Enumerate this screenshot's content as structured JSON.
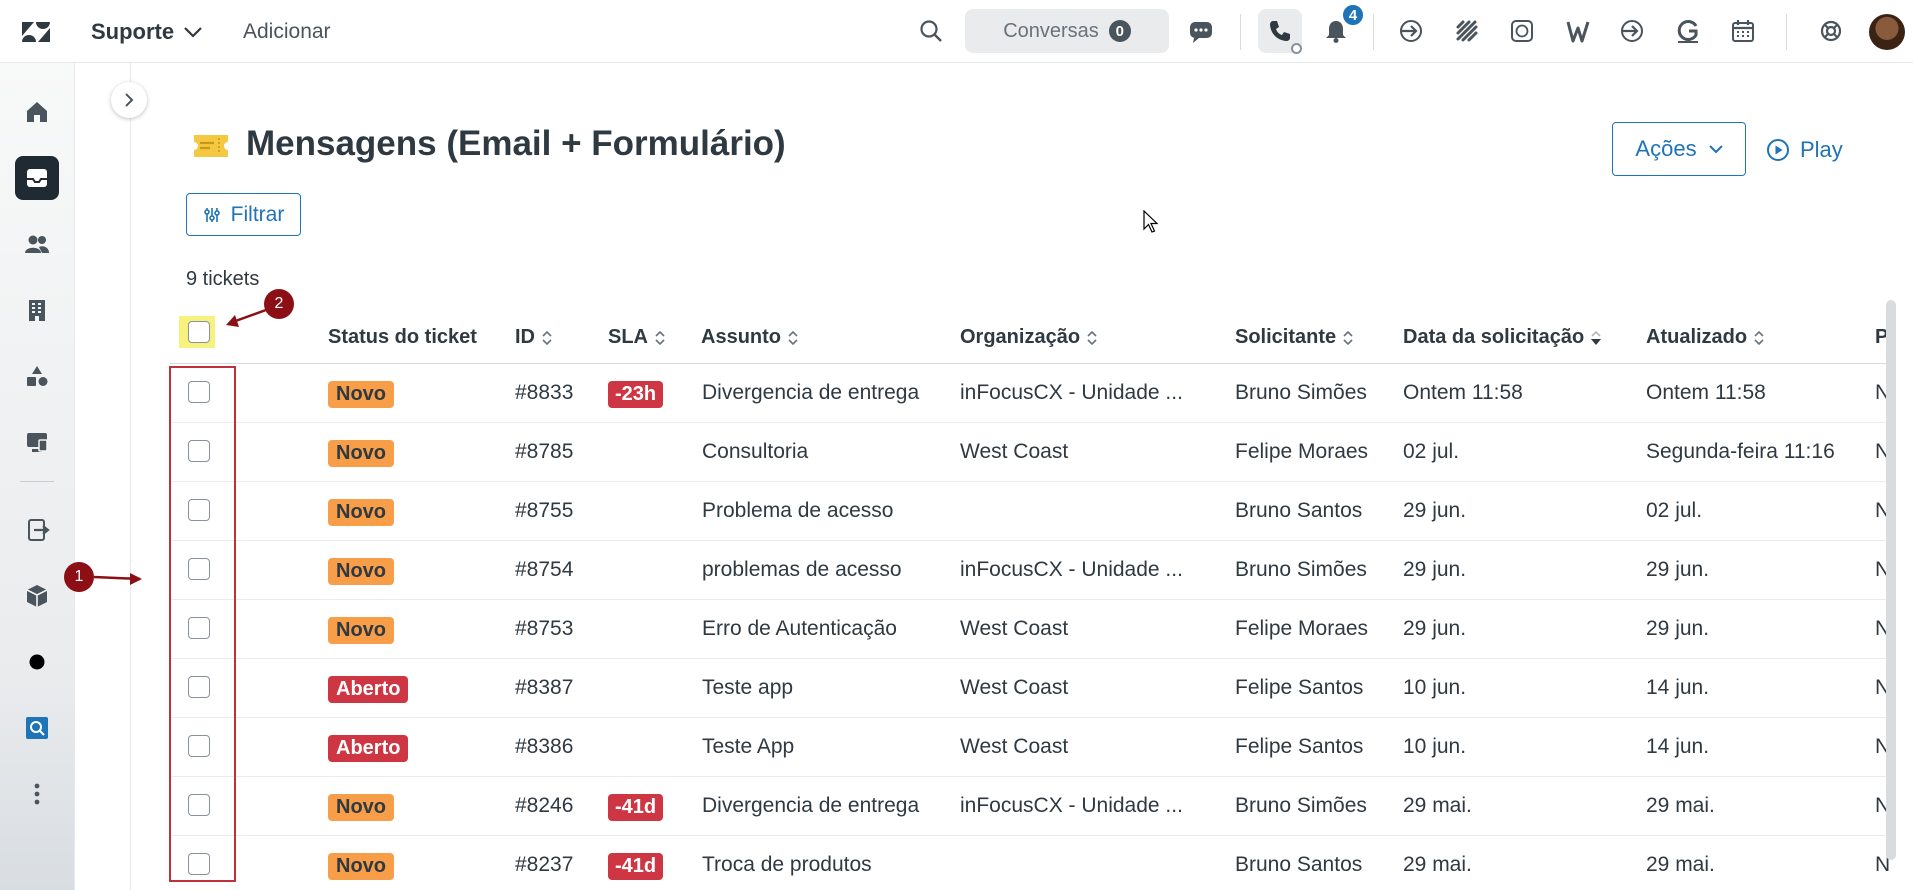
{
  "topbar": {
    "product": "Suporte",
    "add_label": "Adicionar",
    "conversations_label": "Conversas",
    "conversations_count": "0",
    "notifications_count": "4",
    "icons": [
      "search-icon",
      "chat-icon",
      "phone-icon",
      "bell-icon",
      "app-arrow-icon",
      "app-grid-icon",
      "whatsapp-icon",
      "w-app-icon",
      "app-arrow-2-icon",
      "grammarly-icon",
      "calendar-icon",
      "help-icon"
    ]
  },
  "leftnav": {
    "items": [
      "home-icon",
      "views-icon",
      "customers-icon",
      "organizations-icon",
      "reporting-icon",
      "admin-icon",
      "transfer-icon",
      "box-icon",
      "dot-icon",
      "app-icon",
      "more-icon"
    ]
  },
  "view": {
    "title": "Mensagens (Email + Formulário)",
    "actions_label": "Ações",
    "play_label": "Play",
    "filter_label": "Filtrar",
    "count_label": "9 tickets"
  },
  "table": {
    "headers": {
      "status": "Status do ticket",
      "id": "ID",
      "sla": "SLA",
      "subject": "Assunto",
      "org": "Organização",
      "requester": "Solicitante",
      "requested": "Data da solicitação",
      "updated": "Atualizado",
      "extra": "P"
    },
    "rows": [
      {
        "status": "Novo",
        "status_kind": "novo",
        "id": "#8833",
        "sla": "-23h",
        "subject": "Divergencia de entrega",
        "org": "inFocusCX - Unidade ...",
        "requester": "Bruno Simões",
        "requested": "Ontem 11:58",
        "updated": "Ontem 11:58",
        "extra": "N"
      },
      {
        "status": "Novo",
        "status_kind": "novo",
        "id": "#8785",
        "sla": "",
        "subject": "Consultoria",
        "org": "West Coast",
        "requester": "Felipe Moraes",
        "requested": "02 jul.",
        "updated": "Segunda-feira 11:16",
        "extra": "N"
      },
      {
        "status": "Novo",
        "status_kind": "novo",
        "id": "#8755",
        "sla": "",
        "subject": "Problema de acesso",
        "org": "",
        "requester": "Bruno Santos",
        "requested": "29 jun.",
        "updated": "02 jul.",
        "extra": "N"
      },
      {
        "status": "Novo",
        "status_kind": "novo",
        "id": "#8754",
        "sla": "",
        "subject": "problemas de acesso",
        "org": "inFocusCX - Unidade ...",
        "requester": "Bruno Simões",
        "requested": "29 jun.",
        "updated": "29 jun.",
        "extra": "N"
      },
      {
        "status": "Novo",
        "status_kind": "novo",
        "id": "#8753",
        "sla": "",
        "subject": "Erro de Autenticação",
        "org": "West Coast",
        "requester": "Felipe Moraes",
        "requested": "29 jun.",
        "updated": "29 jun.",
        "extra": "N"
      },
      {
        "status": "Aberto",
        "status_kind": "aberto",
        "id": "#8387",
        "sla": "",
        "subject": "Teste app",
        "org": "West Coast",
        "requester": "Felipe Santos",
        "requested": "10 jun.",
        "updated": "14 jun.",
        "extra": "N"
      },
      {
        "status": "Aberto",
        "status_kind": "aberto",
        "id": "#8386",
        "sla": "",
        "subject": "Teste App",
        "org": "West Coast",
        "requester": "Felipe Santos",
        "requested": "10 jun.",
        "updated": "14 jun.",
        "extra": "N"
      },
      {
        "status": "Novo",
        "status_kind": "novo",
        "id": "#8246",
        "sla": "-41d",
        "subject": "Divergencia de entrega",
        "org": "inFocusCX - Unidade ...",
        "requester": "Bruno Simões",
        "requested": "29 mai.",
        "updated": "29 mai.",
        "extra": "N"
      },
      {
        "status": "Novo",
        "status_kind": "novo",
        "id": "#8237",
        "sla": "-41d",
        "subject": "Troca de produtos",
        "org": "",
        "requester": "Bruno Santos",
        "requested": "29 mai.",
        "updated": "29 mai.",
        "extra": "N"
      }
    ]
  },
  "annotations": {
    "marker_1": "1",
    "marker_2": "2"
  },
  "colors": {
    "accent": "#1f73b7",
    "novo": "#f89e49",
    "aberto": "#cd3642",
    "sla": "#cd3642",
    "annotation": "#8b0f14",
    "highlight": "#f7f17e"
  }
}
